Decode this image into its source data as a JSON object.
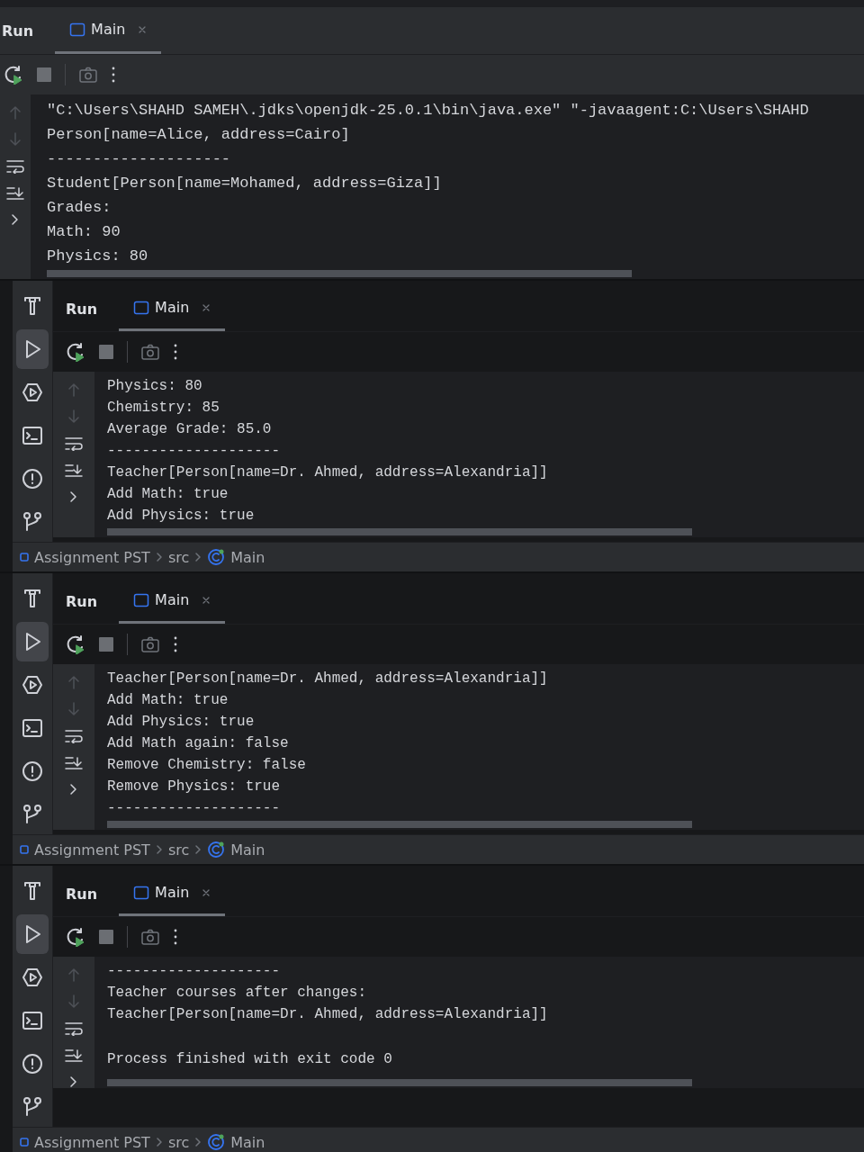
{
  "panels": [
    {
      "tool_title": "Run",
      "tabs": [
        {
          "label": "Main",
          "selected": true
        }
      ],
      "lines": [
        {
          "text": "\"C:\\Users\\SHAHD SAMEH\\.jdks\\openjdk-25.0.1\\bin\\java.exe\" \"-javaagent:C:\\Users\\SHAHD"
        },
        {
          "text": "Person[name=Alice, address=Cairo]"
        },
        {
          "text": "--------------------"
        },
        {
          "text": "Student[Person[name=Mohamed, address=Giza]]"
        },
        {
          "text": "Grades:"
        },
        {
          "text": "Math: 90"
        },
        {
          "text": "Physics: 80"
        }
      ]
    },
    {
      "sidebar": [
        {
          "kind": "build",
          "selected": false
        },
        {
          "kind": "run",
          "selected": true
        },
        {
          "kind": "services",
          "selected": false
        },
        {
          "kind": "terminal",
          "selected": false
        },
        {
          "kind": "problems",
          "selected": false
        },
        {
          "kind": "git",
          "selected": false
        }
      ],
      "tool_title": "Run",
      "tabs": [
        {
          "label": "Main",
          "selected": true
        }
      ],
      "lines": [
        {
          "text": "Physics: 80"
        },
        {
          "text": "Chemistry: 85"
        },
        {
          "text": "Average Grade: 85.0"
        },
        {
          "text": "--------------------"
        },
        {
          "text": "Teacher[Person[name=Dr. Ahmed, address=Alexandria]]"
        },
        {
          "text": "Add Math: true"
        },
        {
          "text": "Add Physics: true"
        }
      ],
      "breadcrumb": [
        {
          "kind": "project",
          "label": "Assignment PST"
        },
        {
          "kind": "folder",
          "label": "src"
        },
        {
          "kind": "class",
          "label": "Main"
        }
      ]
    },
    {
      "sidebar": [
        {
          "kind": "build",
          "selected": false
        },
        {
          "kind": "run",
          "selected": true
        },
        {
          "kind": "services",
          "selected": false
        },
        {
          "kind": "terminal",
          "selected": false
        },
        {
          "kind": "problems",
          "selected": false
        },
        {
          "kind": "git",
          "selected": false
        }
      ],
      "tool_title": "Run",
      "tabs": [
        {
          "label": "Main",
          "selected": true
        }
      ],
      "lines": [
        {
          "text": "Teacher[Person[name=Dr. Ahmed, address=Alexandria]]"
        },
        {
          "text": "Add Math: true"
        },
        {
          "text": "Add Physics: true"
        },
        {
          "text": "Add Math again: false"
        },
        {
          "text": "Remove Chemistry: false"
        },
        {
          "text": "Remove Physics: true"
        },
        {
          "text": "--------------------"
        }
      ],
      "breadcrumb": [
        {
          "kind": "project",
          "label": "Assignment PST"
        },
        {
          "kind": "folder",
          "label": "src"
        },
        {
          "kind": "class",
          "label": "Main"
        }
      ]
    },
    {
      "sidebar": [
        {
          "kind": "build",
          "selected": false
        },
        {
          "kind": "run",
          "selected": true
        },
        {
          "kind": "services",
          "selected": false
        },
        {
          "kind": "terminal",
          "selected": false
        },
        {
          "kind": "problems",
          "selected": false
        },
        {
          "kind": "git",
          "selected": false
        }
      ],
      "tool_title": "Run",
      "tabs": [
        {
          "label": "Main",
          "selected": true
        }
      ],
      "lines": [
        {
          "text": "--------------------"
        },
        {
          "text": "Teacher courses after changes:"
        },
        {
          "text": "Teacher[Person[name=Dr. Ahmed, address=Alexandria]]"
        }
      ],
      "exit_message": "Process finished with exit code 0",
      "breadcrumb": [
        {
          "kind": "project",
          "label": "Assignment PST"
        },
        {
          "kind": "folder",
          "label": "src"
        },
        {
          "kind": "class",
          "label": "Main"
        }
      ]
    }
  ]
}
